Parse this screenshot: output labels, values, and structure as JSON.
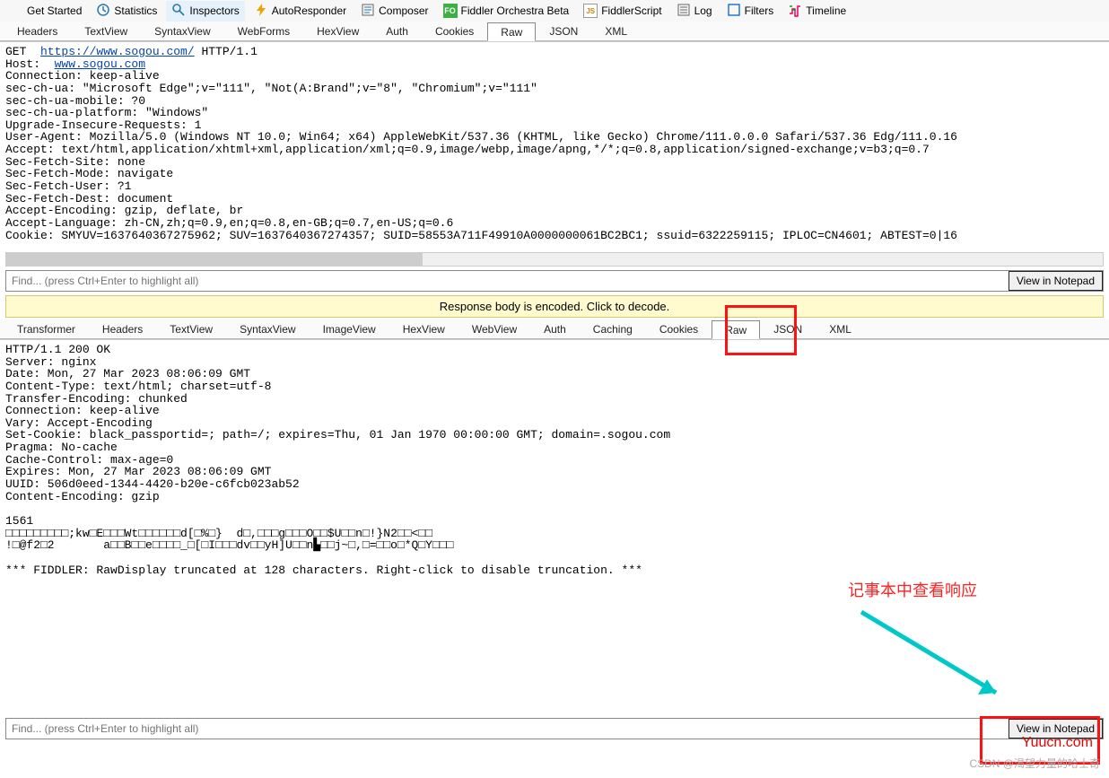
{
  "toolbar": [
    {
      "label": "Get Started",
      "icon": "start"
    },
    {
      "label": "Statistics",
      "icon": "clock"
    },
    {
      "label": "Inspectors",
      "icon": "search",
      "active": true
    },
    {
      "label": "AutoResponder",
      "icon": "bolt"
    },
    {
      "label": "Composer",
      "icon": "compose"
    },
    {
      "label": "Fiddler Orchestra Beta",
      "icon": "fo"
    },
    {
      "label": "FiddlerScript",
      "icon": "js"
    },
    {
      "label": "Log",
      "icon": "log"
    },
    {
      "label": "Filters",
      "icon": "filter"
    },
    {
      "label": "Timeline",
      "icon": "timeline"
    }
  ],
  "request_tabs": [
    "Headers",
    "TextView",
    "SyntaxView",
    "WebForms",
    "HexView",
    "Auth",
    "Cookies",
    "Raw",
    "JSON",
    "XML"
  ],
  "request_tab_active": "Raw",
  "request_raw": {
    "lines": [
      {
        "pre": "GET  ",
        "link": "https://www.sogou.com/",
        "post": " HTTP/1.1"
      },
      {
        "pre": "Host:  ",
        "link": "www.sogou.com",
        "post": ""
      },
      {
        "text": "Connection: keep-alive"
      },
      {
        "text": "sec-ch-ua: \"Microsoft Edge\";v=\"111\", \"Not(A:Brand\";v=\"8\", \"Chromium\";v=\"111\""
      },
      {
        "text": "sec-ch-ua-mobile: ?0"
      },
      {
        "text": "sec-ch-ua-platform: \"Windows\""
      },
      {
        "text": "Upgrade-Insecure-Requests: 1"
      },
      {
        "text": "User-Agent: Mozilla/5.0 (Windows NT 10.0; Win64; x64) AppleWebKit/537.36 (KHTML, like Gecko) Chrome/111.0.0.0 Safari/537.36 Edg/111.0.16"
      },
      {
        "text": "Accept: text/html,application/xhtml+xml,application/xml;q=0.9,image/webp,image/apng,*/*;q=0.8,application/signed-exchange;v=b3;q=0.7"
      },
      {
        "text": "Sec-Fetch-Site: none"
      },
      {
        "text": "Sec-Fetch-Mode: navigate"
      },
      {
        "text": "Sec-Fetch-User: ?1"
      },
      {
        "text": "Sec-Fetch-Dest: document"
      },
      {
        "text": "Accept-Encoding: gzip, deflate, br"
      },
      {
        "text": "Accept-Language: zh-CN,zh;q=0.9,en;q=0.8,en-GB;q=0.7,en-US;q=0.6"
      },
      {
        "text": "Cookie: SMYUV=1637640367275962; SUV=1637640367274357; SUID=58553A711F49910A0000000061BC2BC1; ssuid=6322259115; IPLOC=CN4601; ABTEST=0|16"
      }
    ]
  },
  "find": {
    "placeholder": "Find... (press Ctrl+Enter to highlight all)",
    "notepad": "View in Notepad"
  },
  "banner": "Response body is encoded. Click to decode.",
  "response_tabs": [
    "Transformer",
    "Headers",
    "TextView",
    "SyntaxView",
    "ImageView",
    "HexView",
    "WebView",
    "Auth",
    "Caching",
    "Cookies",
    "Raw",
    "JSON",
    "XML"
  ],
  "response_tab_active": "Raw",
  "response_raw": [
    "HTTP/1.1 200 OK",
    "Server: nginx",
    "Date: Mon, 27 Mar 2023 08:06:09 GMT",
    "Content-Type: text/html; charset=utf-8",
    "Transfer-Encoding: chunked",
    "Connection: keep-alive",
    "Vary: Accept-Encoding",
    "Set-Cookie: black_passportid=; path=/; expires=Thu, 01 Jan 1970 00:00:00 GMT; domain=.sogou.com",
    "Pragma: No-cache",
    "Cache-Control: max-age=0",
    "Expires: Mon, 27 Mar 2023 08:06:09 GMT",
    "UUID: 506d0eed-1344-4420-b20e-c6fcb023ab52",
    "Content-Encoding: gzip",
    "",
    "1561",
    "□□□□□□□□□;kw□E□□□Wt□□□□□□d[□%□}  d□,□□□g□□□O□□$U□□n□!}N2□□<□□",
    "!□@f2□2       a□□B□□e□□□□_□[□I□□□dv□□yH]U□□n▙□□j~□,□=□□o□*Q□Y□□□",
    "",
    "*** FIDDLER: RawDisplay truncated at 128 characters. Right-click to disable truncation. ***"
  ],
  "annotation": {
    "text": "记事本中查看响应"
  },
  "footer": {
    "csdn": "CSDN @渴望力量的哈士奇",
    "yuucn": "Yuucn.com"
  }
}
